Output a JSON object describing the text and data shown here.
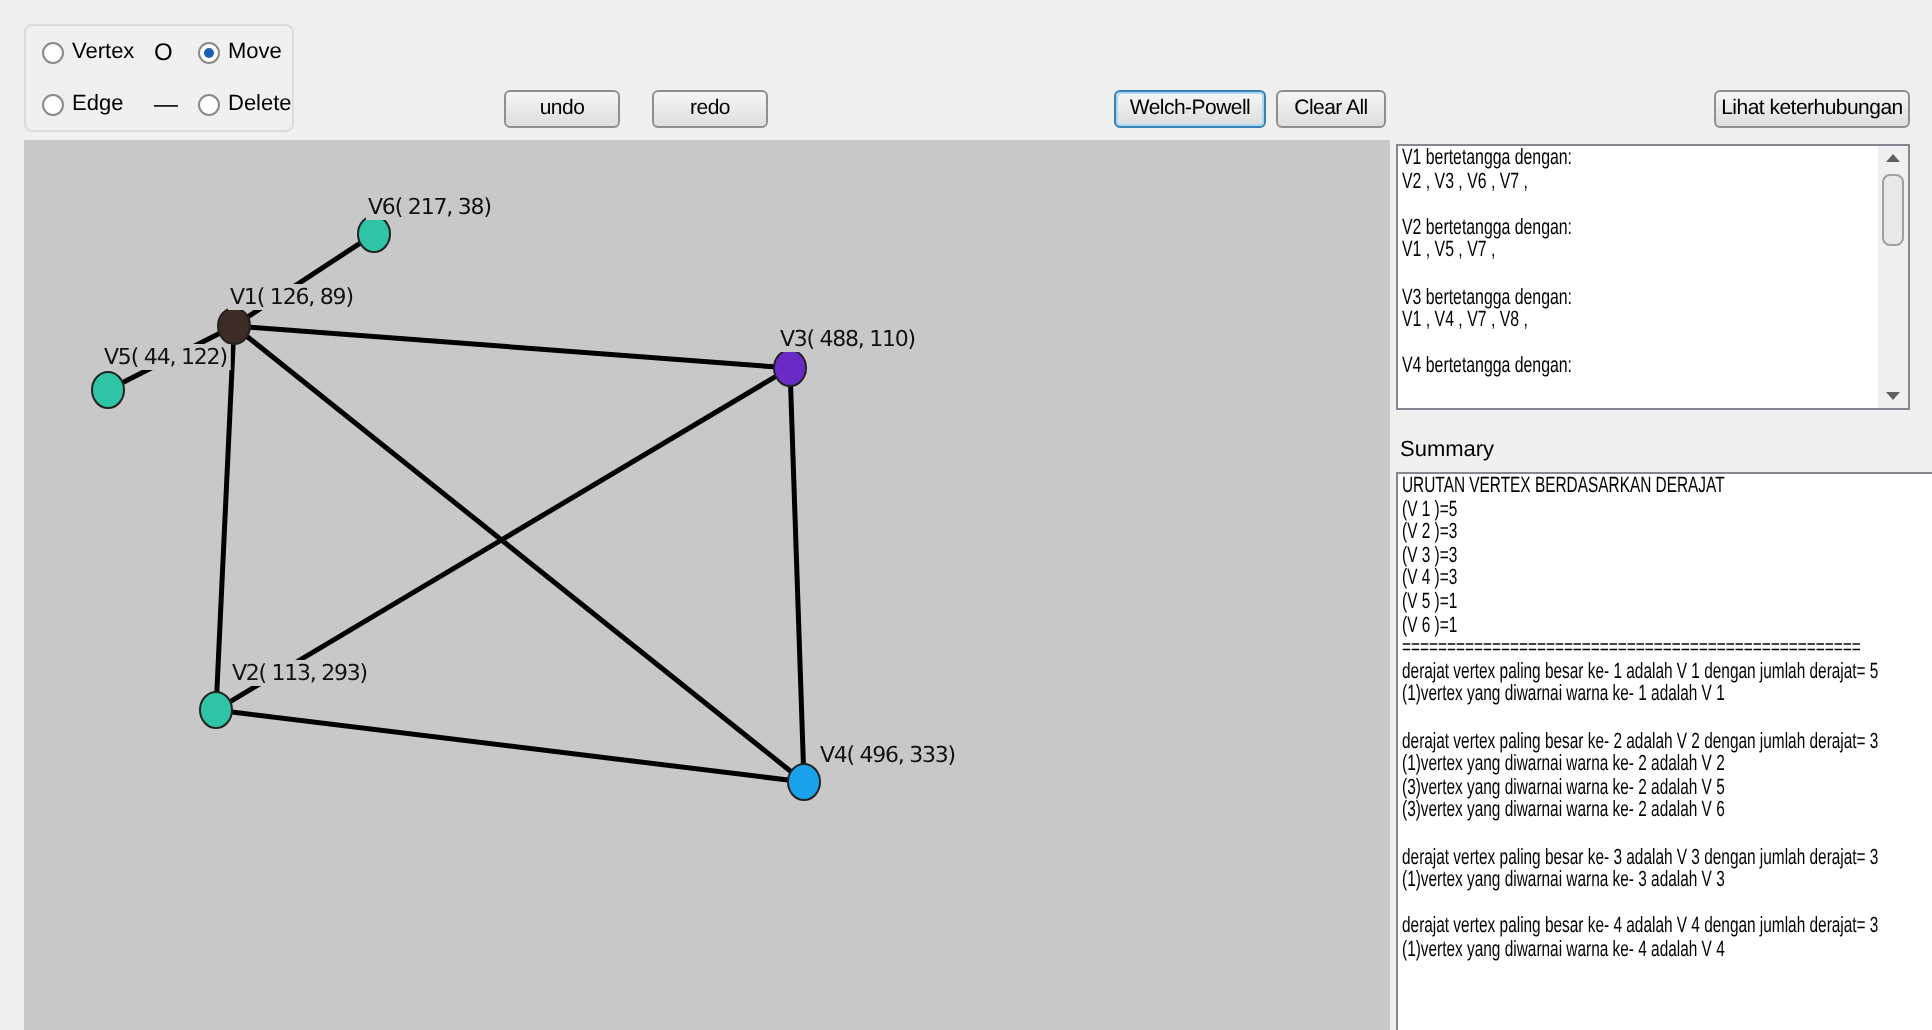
{
  "mode_options": [
    {
      "label": "Vertex",
      "selected": false
    },
    {
      "label": "Move",
      "selected": true
    },
    {
      "label": "Edge",
      "selected": false
    },
    {
      "label": "Delete",
      "selected": false
    }
  ],
  "mode_symbols": [
    "O",
    "—"
  ],
  "toolbar_buttons": [
    {
      "label": "undo",
      "focused": false
    },
    {
      "label": "redo",
      "focused": false
    },
    {
      "label": "Welch-Powell",
      "focused": true
    },
    {
      "label": "Clear All",
      "focused": false
    },
    {
      "label": "Lihat keterhubungan",
      "focused": false
    }
  ],
  "graph": {
    "vertices": [
      {
        "label": "V1( 126, 89)",
        "color": "#3d2b25"
      },
      {
        "label": "V2( 113, 293)",
        "color": "#2fc4a6"
      },
      {
        "label": "V3( 488, 110)",
        "color": "#6a2ac8"
      },
      {
        "label": "V4( 496, 333)",
        "color": "#1aa3ec"
      },
      {
        "label": "V5( 44, 122)",
        "color": "#2fc4a6"
      },
      {
        "label": "V6( 217, 38)",
        "color": "#2fc4a6"
      }
    ],
    "edges": [
      {
        "kind": "line"
      },
      {
        "kind": "line"
      },
      {
        "kind": "line"
      },
      {
        "kind": "line"
      },
      {
        "kind": "line"
      },
      {
        "kind": "line"
      },
      {
        "kind": "line"
      },
      {
        "kind": "line"
      }
    ]
  },
  "neighbors_list": [
    [
      "V1 bertetangga dengan:",
      "V2 , V3 , V6 , V7 ,"
    ],
    [
      "V2 bertetangga dengan:",
      "V1 , V5 , V7 ,"
    ],
    [
      "V3 bertetangga dengan:",
      "V1 , V4 , V7 , V8 ,"
    ],
    [
      "V4 bertetangga dengan:"
    ]
  ],
  "summary": {
    "label": "Summary",
    "paragraphs": [
      [
        "URUTAN VERTEX BERDASARKAN DERAJAT",
        "(V 1 )=5",
        "(V 2 )=3",
        "(V 3 )=3",
        "(V 4 )=3",
        "(V 5 )=1",
        "(V 6 )=1",
        "===================================================",
        "derajat vertex paling besar ke- 1 adalah V 1 dengan jumlah derajat= 5",
        "(1)vertex yang diwarnai warna ke- 1 adalah V 1"
      ],
      [
        "derajat vertex paling besar ke- 2 adalah V 2 dengan jumlah derajat= 3",
        "(1)vertex yang diwarnai warna ke- 2 adalah V 2",
        "(3)vertex yang diwarnai warna ke- 2 adalah V 5",
        "(3)vertex yang diwarnai warna ke- 2 adalah V 6"
      ],
      [
        "derajat vertex paling besar ke- 3 adalah V 3 dengan jumlah derajat= 3",
        "(1)vertex yang diwarnai warna ke- 3 adalah V 3"
      ],
      [
        "derajat vertex paling besar ke- 4 adalah V 4 dengan jumlah derajat= 3",
        "(1)vertex yang diwarnai warna ke- 4 adalah V 4"
      ]
    ]
  }
}
